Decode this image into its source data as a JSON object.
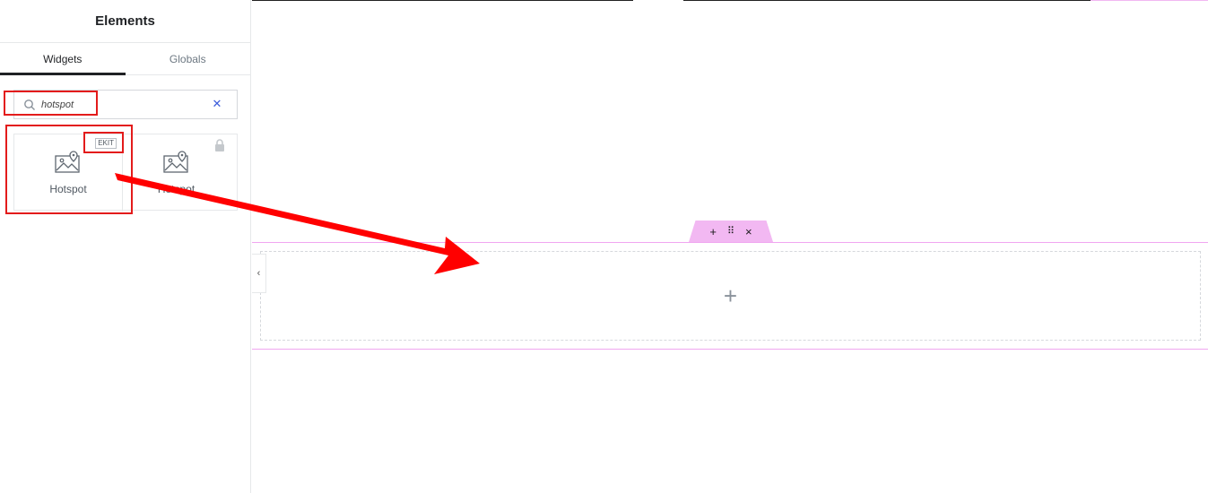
{
  "panel": {
    "title": "Elements",
    "tabs": [
      {
        "label": "Widgets",
        "active": true
      },
      {
        "label": "Globals",
        "active": false
      }
    ]
  },
  "search": {
    "value": "hotspot",
    "clear_icon": "close-icon"
  },
  "widgets": [
    {
      "label": "Hotspot",
      "badge": "EKIT",
      "icon": "image-hotspot-icon"
    },
    {
      "label": "Hotspot",
      "icon": "image-hotspot-icon",
      "locked": true
    }
  ],
  "canvas": {
    "handle": {
      "add": "+",
      "drag": "⠿",
      "close": "×"
    },
    "add_section": "+",
    "collapse": "‹"
  },
  "colors": {
    "annotation": "#e31b1b",
    "section_highlight": "#f2b8f2",
    "accent": "#3b5bdb"
  }
}
